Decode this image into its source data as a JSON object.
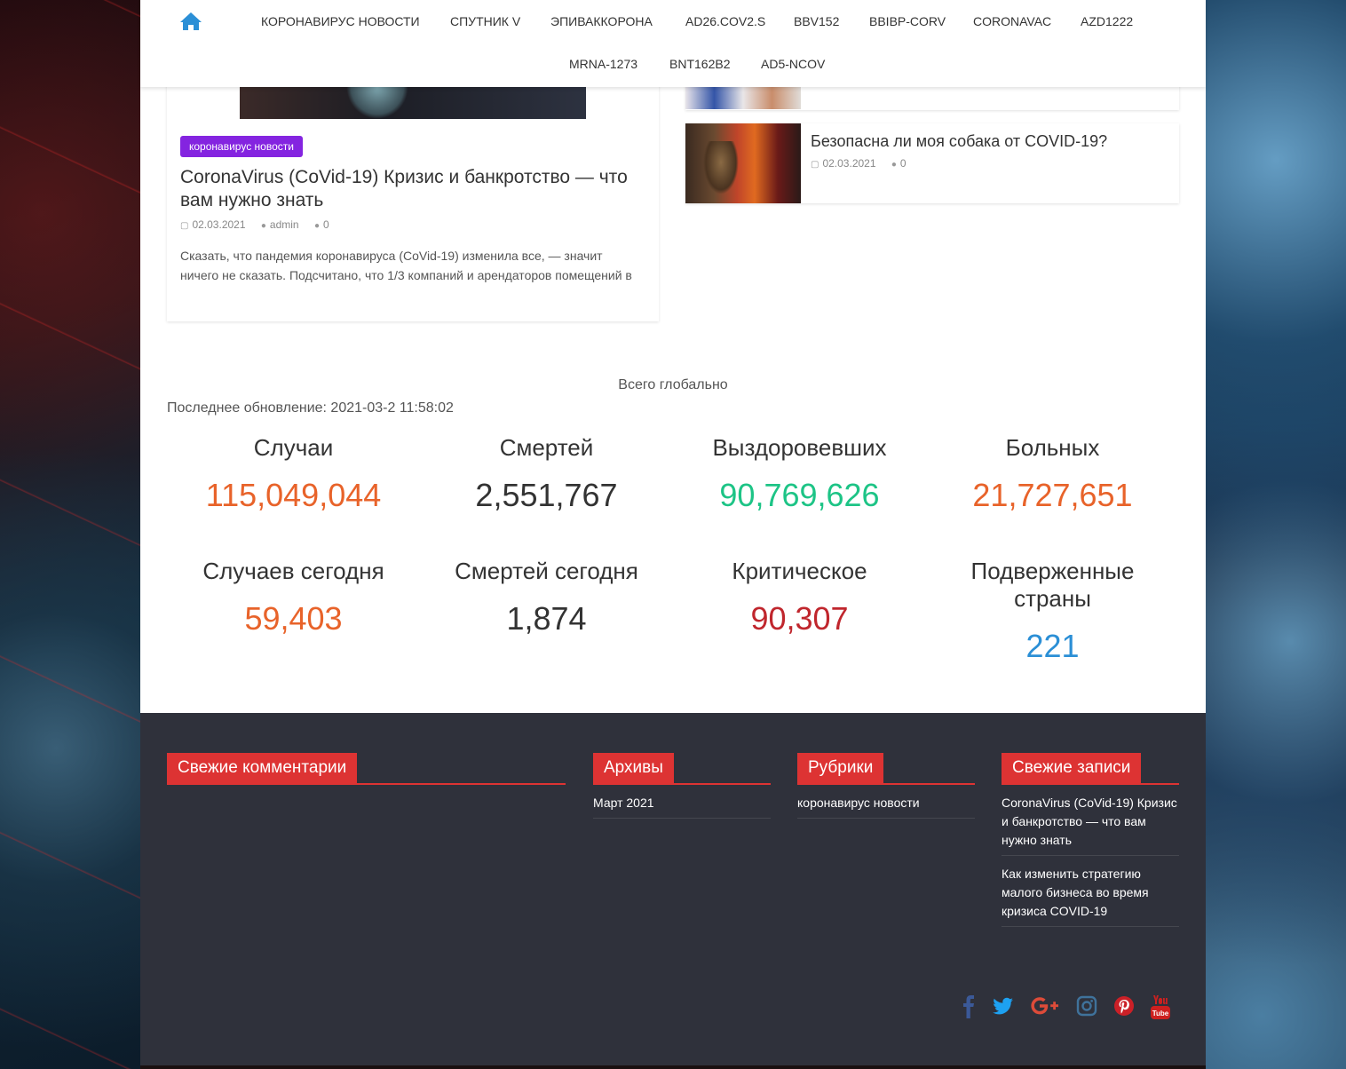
{
  "nav": {
    "items_row1": [
      "КОРОНАВИРУС НОВОСТИ",
      "СПУТНИК V",
      "ЭПИВАККОРОНА",
      "AD26.COV2.S",
      "BBV152",
      "BBIBP-CORV",
      "CORONAVAC",
      "AZD1222"
    ],
    "items_row2": [
      "MRNA-1273",
      "BNT162B2",
      "AD5-NCOV"
    ]
  },
  "featured": {
    "category": "коронавирус новости",
    "title": "CoronaVirus (CoVid-19) Кризис и банкротство — что вам нужно знать",
    "date": "02.03.2021",
    "author": "admin",
    "comments": "0",
    "excerpt": "Сказать, что пандемия коронавируса (CoVid-19) изменила все, — значит ничего не сказать. Подсчитано, что 1/3 компаний и арендаторов помещений в"
  },
  "side_posts": [
    {
      "title": "Безопасна ли моя собака от COVID-19?",
      "date": "02.03.2021",
      "comments": "0"
    }
  ],
  "stats": {
    "title": "Всего глобально",
    "updated": "Последнее обновление: 2021-03-2 11:58:02",
    "items": [
      {
        "label": "Случаи",
        "value": "115,049,044",
        "color": "#e8632a"
      },
      {
        "label": "Смертей",
        "value": "2,551,767",
        "color": "#333333"
      },
      {
        "label": "Выздоровевших",
        "value": "90,769,626",
        "color": "#1dc486"
      },
      {
        "label": "Больных",
        "value": "21,727,651",
        "color": "#e8632a"
      },
      {
        "label": "Случаев сегодня",
        "value": "59,403",
        "color": "#e8632a"
      },
      {
        "label": "Смертей сегодня",
        "value": "1,874",
        "color": "#333333"
      },
      {
        "label": "Критическое",
        "value": "90,307",
        "color": "#c0262d"
      },
      {
        "label": "Подверженные страны",
        "value": "221",
        "color": "#2b8fd6"
      }
    ]
  },
  "footer": {
    "recent_comments": {
      "title": "Свежие комментарии"
    },
    "archives": {
      "title": "Архивы",
      "items": [
        "Март 2021"
      ]
    },
    "categories": {
      "title": "Рубрики",
      "items": [
        "коронавирус новости"
      ]
    },
    "recent_posts": {
      "title": "Свежие записи",
      "items": [
        "CoronaVirus (CoVid-19) Кризис и банкротство — что вам нужно знать",
        "Как изменить стратегию малого бизнеса во время кризиса COVID-19"
      ]
    },
    "social": [
      {
        "name": "facebook-icon",
        "color": "#3b5998"
      },
      {
        "name": "twitter-icon",
        "color": "#1da1f2"
      },
      {
        "name": "google-plus-icon",
        "color": "#dd4b39"
      },
      {
        "name": "instagram-icon",
        "color": "#3f729b"
      },
      {
        "name": "pinterest-icon",
        "color": "#cb2027"
      },
      {
        "name": "youtube-icon",
        "color": "#cd201f"
      }
    ]
  }
}
